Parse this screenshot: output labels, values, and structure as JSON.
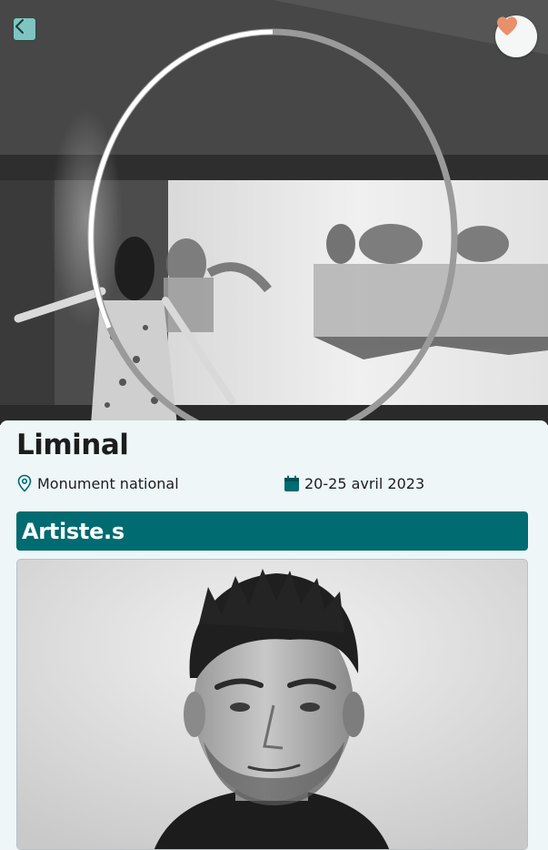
{
  "event": {
    "title": "Liminal",
    "location": "Monument national",
    "dates": "20-25 avril 2023"
  },
  "header": {
    "back_icon": "chevron-left-icon",
    "favorite_icon": "heart-icon"
  },
  "artists_section": {
    "heading": "Artiste.s"
  },
  "colors": {
    "accent": "#006b70",
    "back_button": "#7fc4c0",
    "heart": "#e8906b",
    "background": "#eef6f8"
  }
}
